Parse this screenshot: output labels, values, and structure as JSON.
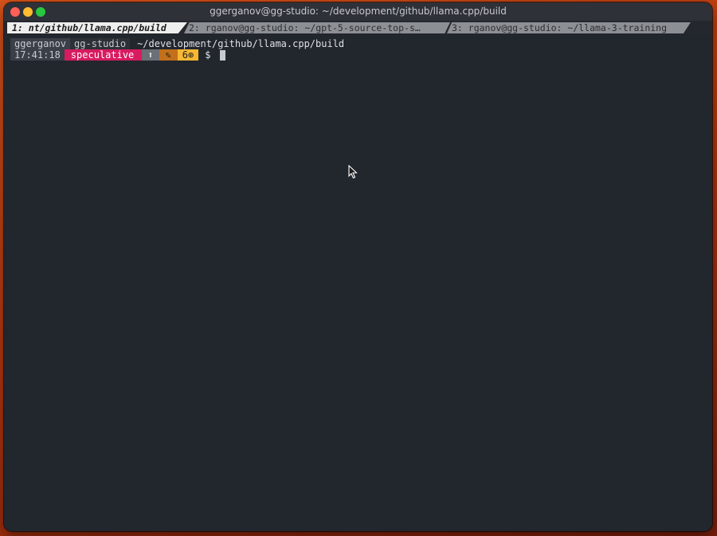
{
  "window": {
    "title": "ggerganov@gg-studio: ~/development/github/llama.cpp/build"
  },
  "tabs": [
    {
      "label": "1: nt/github/llama.cpp/build",
      "active": true
    },
    {
      "label": "2: rganov@gg-studio: ~/gpt-5-source-top-s…",
      "active": false
    },
    {
      "label": "3: rganov@gg-studio: ~/llama-3-training",
      "active": false
    }
  ],
  "prompt": {
    "user": "ggerganov",
    "host": "gg-studio",
    "path": "~/development/github/llama.cpp/build",
    "time": "17:41:18",
    "branch": "speculative",
    "ahead_icon": "⬆",
    "modified_icon": "✎",
    "count": "6⊕",
    "symbol": "$"
  },
  "colors": {
    "branch_bg": "#d81b60",
    "modified_bg": "#c2701a",
    "count_bg": "#f7b733",
    "terminal_bg": "#22262d"
  },
  "icons": [
    "close-button",
    "minimize-button",
    "maximize-button",
    "mouse-pointer-icon"
  ]
}
